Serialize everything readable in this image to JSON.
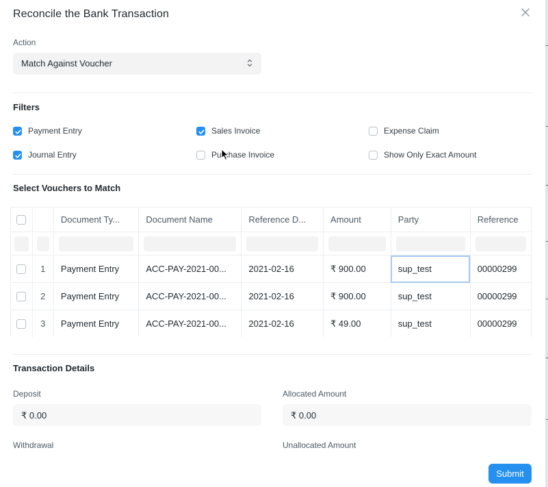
{
  "dialog": {
    "title": "Reconcile the Bank Transaction",
    "close_icon": "close-icon"
  },
  "action": {
    "label": "Action",
    "selected": "Match Against Voucher"
  },
  "filters": {
    "heading": "Filters",
    "items": [
      {
        "label": "Payment Entry",
        "checked": true
      },
      {
        "label": "Sales Invoice",
        "checked": true
      },
      {
        "label": "Expense Claim",
        "checked": false
      },
      {
        "label": "Journal Entry",
        "checked": true
      },
      {
        "label": "Purchase Invoice",
        "checked": false
      },
      {
        "label": "Show Only Exact Amount",
        "checked": false
      }
    ]
  },
  "vouchers": {
    "heading": "Select Vouchers to Match",
    "columns": [
      "Document Ty...",
      "Document Name",
      "Reference D...",
      "Amount",
      "Party",
      "Reference"
    ],
    "rows": [
      {
        "idx": "1",
        "doc_type": "Payment Entry",
        "doc_name": "ACC-PAY-2021-00...",
        "ref_date": "2021-02-16",
        "amount": "₹ 900.00",
        "party": "sup_test",
        "reference": "00000299"
      },
      {
        "idx": "2",
        "doc_type": "Payment Entry",
        "doc_name": "ACC-PAY-2021-00...",
        "ref_date": "2021-02-16",
        "amount": "₹ 900.00",
        "party": "sup_test",
        "reference": "00000299"
      },
      {
        "idx": "3",
        "doc_type": "Payment Entry",
        "doc_name": "ACC-PAY-2021-00...",
        "ref_date": "2021-02-16",
        "amount": "₹ 49.00",
        "party": "sup_test",
        "reference": "00000299"
      }
    ]
  },
  "transaction": {
    "heading": "Transaction Details",
    "deposit_label": "Deposit",
    "deposit_value": "₹ 0.00",
    "allocated_label": "Allocated Amount",
    "allocated_value": "₹ 0.00",
    "withdrawal_label": "Withdrawal",
    "unallocated_label": "Unallocated Amount"
  },
  "submit_label": "Submit",
  "colors": {
    "primary": "#2490ef",
    "focus_outline": "#a6c8f0"
  }
}
